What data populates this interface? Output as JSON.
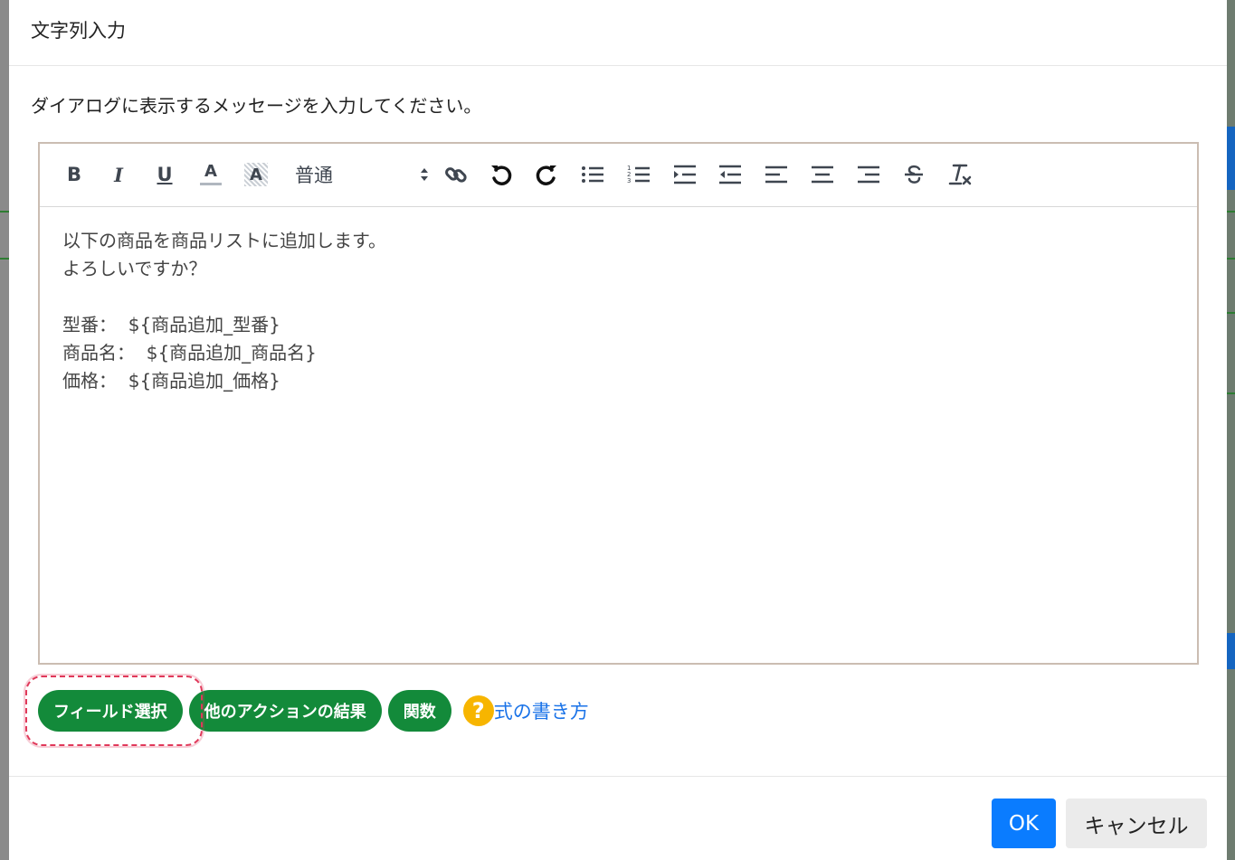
{
  "dialog": {
    "title": "文字列入力",
    "message": "ダイアログに表示するメッセージを入力してください。"
  },
  "toolbar": {
    "items": [
      {
        "name": "bold",
        "label": "B"
      },
      {
        "name": "italic",
        "label": "I"
      },
      {
        "name": "underline",
        "label": "U"
      },
      {
        "name": "font-color",
        "label": "A"
      },
      {
        "name": "background-color",
        "label": "A"
      }
    ],
    "heading_select_value": "普通",
    "icons": [
      "link-icon",
      "undo-icon",
      "redo-icon",
      "bullet-list-icon",
      "numbered-list-icon",
      "indent-icon",
      "outdent-icon",
      "align-left-icon",
      "align-center-icon",
      "align-right-icon",
      "strikethrough-icon",
      "clear-format-icon"
    ]
  },
  "editor": {
    "lines": [
      "以下の商品を商品リストに追加します。",
      "よろしいですか？",
      "",
      "型番：  ${商品追加_型番}",
      "商品名：  ${商品追加_商品名}",
      "価格：  ${商品追加_価格}"
    ]
  },
  "actions": {
    "field_select": "フィールド選択",
    "other_action_result": "他のアクションの結果",
    "function": "関数",
    "help_icon": "?",
    "help_link": "式の書き方"
  },
  "footer": {
    "ok": "OK",
    "cancel": "キャンセル"
  },
  "colors": {
    "action_pill": "#138a3a",
    "ok_button": "#0a7cff",
    "help_icon": "#f7b500",
    "highlight": "#e0395a"
  }
}
